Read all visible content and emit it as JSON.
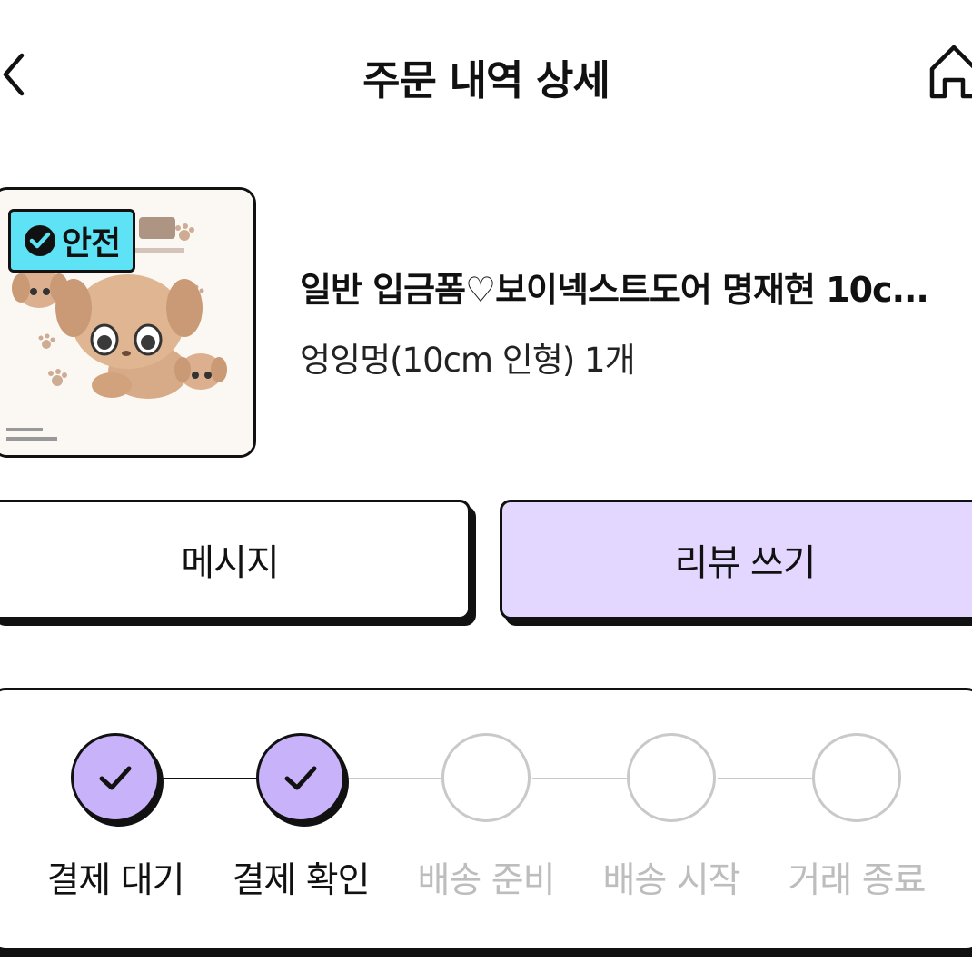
{
  "header": {
    "title": "주문 내역 상세",
    "back_icon": "chevron-left-icon",
    "home_icon": "home-icon"
  },
  "product": {
    "badge_label": "안전",
    "badge_icon": "check-circle-icon",
    "badge_color": "#5de3f5",
    "title": "일반 입금폼♡보이넥스트도어 명재현 10c...",
    "option": "엉잉멍(10cm 인형) 1개"
  },
  "actions": {
    "message_label": "메시지",
    "review_label": "리뷰 쓰기",
    "review_bg": "#e3d7ff"
  },
  "progress": {
    "steps": [
      {
        "label": "결제 대기",
        "done": true
      },
      {
        "label": "결제 확인",
        "done": true
      },
      {
        "label": "배송 준비",
        "done": false
      },
      {
        "label": "배송 시작",
        "done": false
      },
      {
        "label": "거래 종료",
        "done": false
      }
    ],
    "done_color": "#c8b3fb",
    "todo_color": "#c9c9c9"
  }
}
